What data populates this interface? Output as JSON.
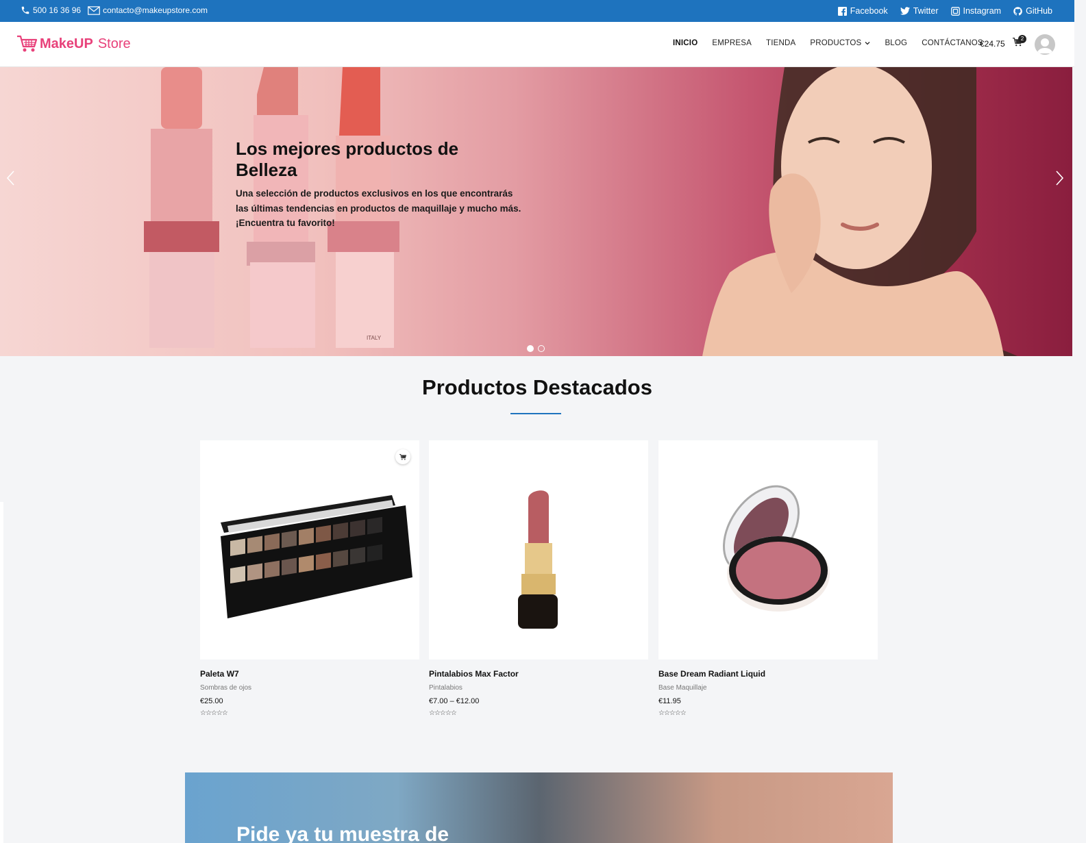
{
  "topbar": {
    "phone": "500 16 36 96",
    "email": "contacto@makeupstore.com",
    "social": [
      "Facebook",
      "Twitter",
      "Instagram",
      "GitHub"
    ]
  },
  "header": {
    "brand_bold": "MakeUP",
    "brand_light": "Store",
    "nav": [
      "INICIO",
      "EMPRESA",
      "TIENDA",
      "PRODUCTOS",
      "BLOG",
      "CONTÁCTANOS"
    ],
    "cart_total": "€24.75",
    "cart_count": "2"
  },
  "hero": {
    "title": "Los mejores productos de Belleza",
    "text": "Una selección de productos exclusivos en los que encontrarás las últimas tendencias en productos de maquillaje y mucho más. ¡Encuentra tu favorito!",
    "lipstick_mark": "ITALY",
    "slides": 2,
    "active_slide": 1
  },
  "featured": {
    "title": "Productos Destacados",
    "products": [
      {
        "name": "Paleta W7",
        "category": "Sombras de ojos",
        "price": "€25.00",
        "rating": "☆☆☆☆☆"
      },
      {
        "name": "Pintalabios Max Factor",
        "category": "Pintalabios",
        "price": "€7.00 – €12.00",
        "rating": "☆☆☆☆☆"
      },
      {
        "name": "Base Dream Radiant Liquid",
        "category": "Base Maquillaje",
        "price": "€11.95",
        "rating": "☆☆☆☆☆"
      }
    ]
  },
  "banner": {
    "text": "Pide ya tu muestra de"
  },
  "colors": {
    "topbar": "#1e73be",
    "brand": "#e8417a",
    "accent_line": "#1e73be"
  },
  "icons": [
    "phone-icon",
    "mail-icon",
    "facebook-icon",
    "twitter-icon",
    "instagram-icon",
    "github-icon",
    "cart-icon",
    "user-avatar-icon",
    "chevron-down-icon",
    "chevron-left-icon",
    "chevron-right-icon"
  ]
}
